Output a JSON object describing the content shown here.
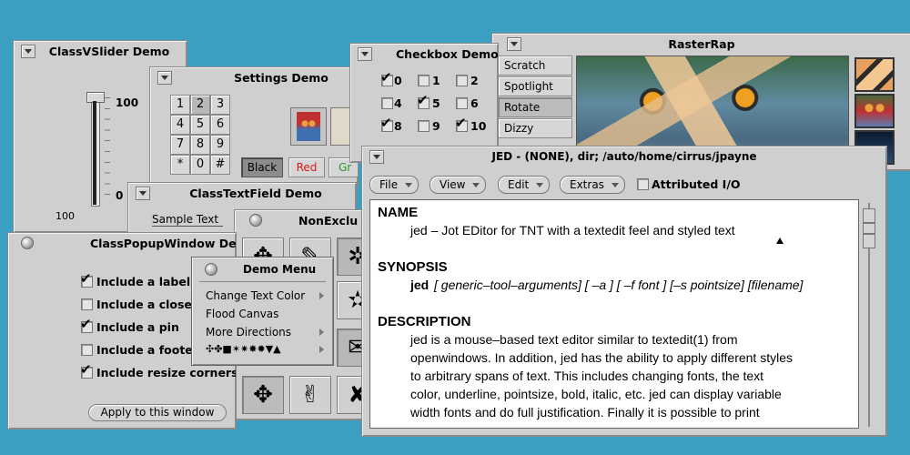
{
  "vslider": {
    "title": "ClassVSlider Demo",
    "max_label": "100",
    "min_label": "0",
    "footer_label": "100"
  },
  "settings": {
    "title": "Settings Demo",
    "keys": [
      "1",
      "2",
      "3",
      "4",
      "5",
      "6",
      "7",
      "8",
      "9",
      "*",
      "0",
      "#"
    ],
    "color_black": "Black",
    "color_red": "Red",
    "color_green": "Gr"
  },
  "checkbox_demo": {
    "title": "Checkbox Demo",
    "items": [
      {
        "label": "0",
        "checked": true
      },
      {
        "label": "1",
        "checked": false
      },
      {
        "label": "2",
        "checked": false
      },
      {
        "label": "4",
        "checked": false
      },
      {
        "label": "5",
        "checked": true
      },
      {
        "label": "6",
        "checked": false
      },
      {
        "label": "8",
        "checked": true
      },
      {
        "label": "9",
        "checked": false
      },
      {
        "label": "10",
        "checked": true
      }
    ]
  },
  "rasterrap": {
    "title": "RasterRap",
    "items": [
      "Scratch",
      "Spotlight",
      "Rotate",
      "Dizzy"
    ],
    "selected": "Rotate"
  },
  "textfield": {
    "title": "ClassTextField Demo",
    "sample": "Sample Text"
  },
  "nonexclusive": {
    "title": "NonExclu"
  },
  "popup": {
    "title": "ClassPopupWindow Demo",
    "options": [
      {
        "label": "Include a label",
        "checked": true
      },
      {
        "label": "Include a close",
        "checked": false
      },
      {
        "label": "Include a pin",
        "checked": true
      },
      {
        "label": "Include a footer",
        "checked": false
      },
      {
        "label": "Include resize corners",
        "checked": true
      }
    ],
    "apply_button": "Apply to this window"
  },
  "demo_menu": {
    "title": "Demo Menu",
    "items": [
      {
        "label": "Change Text Color",
        "submenu": true
      },
      {
        "label": "Flood Canvas",
        "submenu": false
      },
      {
        "label": "More Directions",
        "submenu": true
      },
      {
        "label": "✣✤■✶✷✸✹▼▲",
        "submenu": true
      }
    ]
  },
  "jed": {
    "title": "JED - (NONE), dir; /auto/home/cirrus/jpayne",
    "menus": [
      "File",
      "View",
      "Edit",
      "Extras"
    ],
    "attributed_io": "Attributed I/O",
    "doc": {
      "name_heading": "NAME",
      "name_text": "jed – Jot EDitor for TNT with a textedit feel and styled text",
      "synopsis_heading": "SYNOPSIS",
      "synopsis_cmd": "jed",
      "synopsis_args": "[ generic–tool–arguments] [ –a ] [ –f font ] [–s pointsize] [filename]",
      "description_heading": "DESCRIPTION",
      "description_lines": [
        "jed is a mouse–based text editor similar to textedit(1) from",
        "openwindows.  In addition, jed has the ability to apply different styles",
        "to arbitrary spans of text.  This includes changing fonts, the text",
        "color, underline, pointsize, bold, italic, etc.  jed can display variable",
        "width fonts and do full justification.  Finally it is possible to print"
      ]
    }
  },
  "colors": {
    "desktop": "#3b9ec3",
    "window": "#cfcfcf",
    "red": "#d81818",
    "green": "#2a9a2a"
  }
}
